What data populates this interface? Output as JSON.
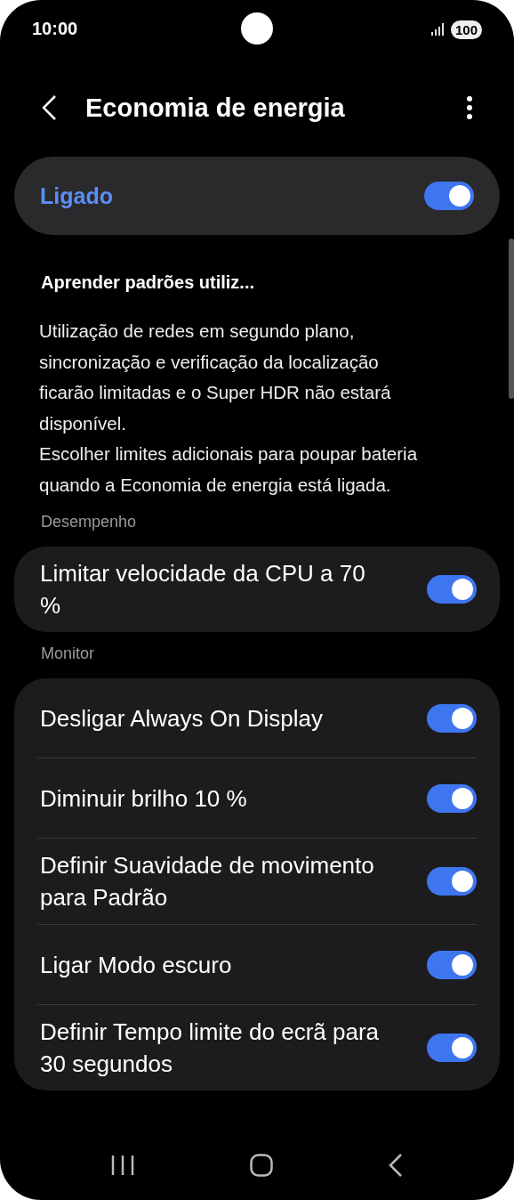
{
  "status_bar": {
    "time": "10:00",
    "battery": "100"
  },
  "header": {
    "title": "Economia de energia"
  },
  "master_switch": {
    "label": "Ligado",
    "on": true
  },
  "learn_title": "Aprender padrões utiliz...",
  "description": [
    "Utilização de redes em segundo plano, sincronização e verificação da localização ficarão limitadas e o Super HDR não estará disponível.",
    "Escolher limites adicionais para poupar bateria quando a Economia de energia está ligada."
  ],
  "sections": [
    {
      "title": "Desempenho",
      "items": [
        {
          "label": "Limitar velocidade da CPU a 70 %",
          "on": true
        }
      ]
    },
    {
      "title": "Monitor",
      "items": [
        {
          "label": "Desligar Always On Display",
          "on": true
        },
        {
          "label": "Diminuir brilho 10 %",
          "on": true
        },
        {
          "label": "Definir Suavidade de movimento para Padrão",
          "on": true
        },
        {
          "label": "Ligar Modo escuro",
          "on": true
        },
        {
          "label": "Definir Tempo limite do ecrã para 30 segundos",
          "on": true
        }
      ]
    }
  ]
}
